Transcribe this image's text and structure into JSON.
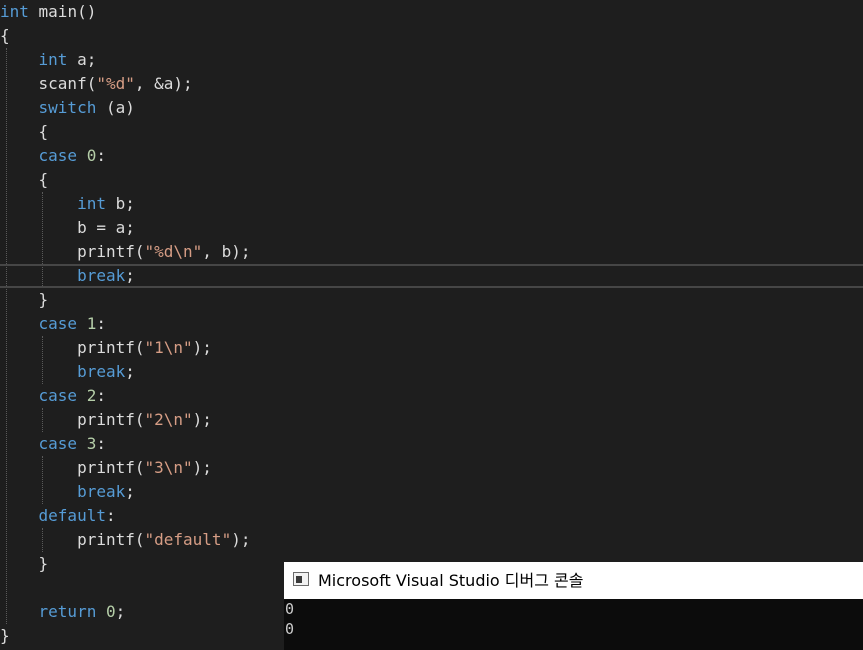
{
  "editor": {
    "lines": [
      [
        {
          "t": "int",
          "c": "kw"
        },
        {
          "t": " main()",
          "c": "plain"
        }
      ],
      [
        {
          "t": "{",
          "c": "plain"
        }
      ],
      [
        {
          "t": "    ",
          "c": "plain"
        },
        {
          "t": "int",
          "c": "kw"
        },
        {
          "t": " a;",
          "c": "plain"
        }
      ],
      [
        {
          "t": "    scanf(",
          "c": "plain"
        },
        {
          "t": "\"%d\"",
          "c": "str"
        },
        {
          "t": ", &a);",
          "c": "plain"
        }
      ],
      [
        {
          "t": "    ",
          "c": "plain"
        },
        {
          "t": "switch",
          "c": "kw"
        },
        {
          "t": " (a)",
          "c": "plain"
        }
      ],
      [
        {
          "t": "    {",
          "c": "plain"
        }
      ],
      [
        {
          "t": "    ",
          "c": "plain"
        },
        {
          "t": "case",
          "c": "kw"
        },
        {
          "t": " ",
          "c": "plain"
        },
        {
          "t": "0",
          "c": "num"
        },
        {
          "t": ":",
          "c": "plain"
        }
      ],
      [
        {
          "t": "    {",
          "c": "plain"
        }
      ],
      [
        {
          "t": "        ",
          "c": "plain"
        },
        {
          "t": "int",
          "c": "kw"
        },
        {
          "t": " b;",
          "c": "plain"
        }
      ],
      [
        {
          "t": "        b = a;",
          "c": "plain"
        }
      ],
      [
        {
          "t": "        printf(",
          "c": "plain"
        },
        {
          "t": "\"%d\\n\"",
          "c": "str"
        },
        {
          "t": ", b);",
          "c": "plain"
        }
      ],
      [
        {
          "t": "        ",
          "c": "plain"
        },
        {
          "t": "break",
          "c": "kw"
        },
        {
          "t": ";",
          "c": "plain"
        }
      ],
      [
        {
          "t": "    }",
          "c": "plain"
        }
      ],
      [
        {
          "t": "    ",
          "c": "plain"
        },
        {
          "t": "case",
          "c": "kw"
        },
        {
          "t": " ",
          "c": "plain"
        },
        {
          "t": "1",
          "c": "num"
        },
        {
          "t": ":",
          "c": "plain"
        }
      ],
      [
        {
          "t": "        printf(",
          "c": "plain"
        },
        {
          "t": "\"1\\n\"",
          "c": "str"
        },
        {
          "t": ");",
          "c": "plain"
        }
      ],
      [
        {
          "t": "        ",
          "c": "plain"
        },
        {
          "t": "break",
          "c": "kw"
        },
        {
          "t": ";",
          "c": "plain"
        }
      ],
      [
        {
          "t": "    ",
          "c": "plain"
        },
        {
          "t": "case",
          "c": "kw"
        },
        {
          "t": " ",
          "c": "plain"
        },
        {
          "t": "2",
          "c": "num"
        },
        {
          "t": ":",
          "c": "plain"
        }
      ],
      [
        {
          "t": "        printf(",
          "c": "plain"
        },
        {
          "t": "\"2\\n\"",
          "c": "str"
        },
        {
          "t": ");",
          "c": "plain"
        }
      ],
      [
        {
          "t": "    ",
          "c": "plain"
        },
        {
          "t": "case",
          "c": "kw"
        },
        {
          "t": " ",
          "c": "plain"
        },
        {
          "t": "3",
          "c": "num"
        },
        {
          "t": ":",
          "c": "plain"
        }
      ],
      [
        {
          "t": "        printf(",
          "c": "plain"
        },
        {
          "t": "\"3\\n\"",
          "c": "str"
        },
        {
          "t": ");",
          "c": "plain"
        }
      ],
      [
        {
          "t": "        ",
          "c": "plain"
        },
        {
          "t": "break",
          "c": "kw"
        },
        {
          "t": ";",
          "c": "plain"
        }
      ],
      [
        {
          "t": "    ",
          "c": "plain"
        },
        {
          "t": "default",
          "c": "kw"
        },
        {
          "t": ":",
          "c": "plain"
        }
      ],
      [
        {
          "t": "        printf(",
          "c": "plain"
        },
        {
          "t": "\"default\"",
          "c": "str"
        },
        {
          "t": ");",
          "c": "plain"
        }
      ],
      [
        {
          "t": "    }",
          "c": "plain"
        }
      ],
      [],
      [
        {
          "t": "    ",
          "c": "plain"
        },
        {
          "t": "return",
          "c": "kw"
        },
        {
          "t": " ",
          "c": "plain"
        },
        {
          "t": "0",
          "c": "num"
        },
        {
          "t": ";",
          "c": "plain"
        }
      ],
      [
        {
          "t": "}",
          "c": "plain"
        }
      ]
    ],
    "current_line": 12,
    "colors": {
      "background": "#1e1e1e",
      "keyword": "#569cd6",
      "string": "#d69d85",
      "number": "#b5cea8",
      "plain": "#dcdcdc"
    }
  },
  "console": {
    "title": "Microsoft Visual Studio 디버그 콘솔",
    "icon": "console-window-icon",
    "output_lines": [
      "0",
      "0"
    ]
  }
}
